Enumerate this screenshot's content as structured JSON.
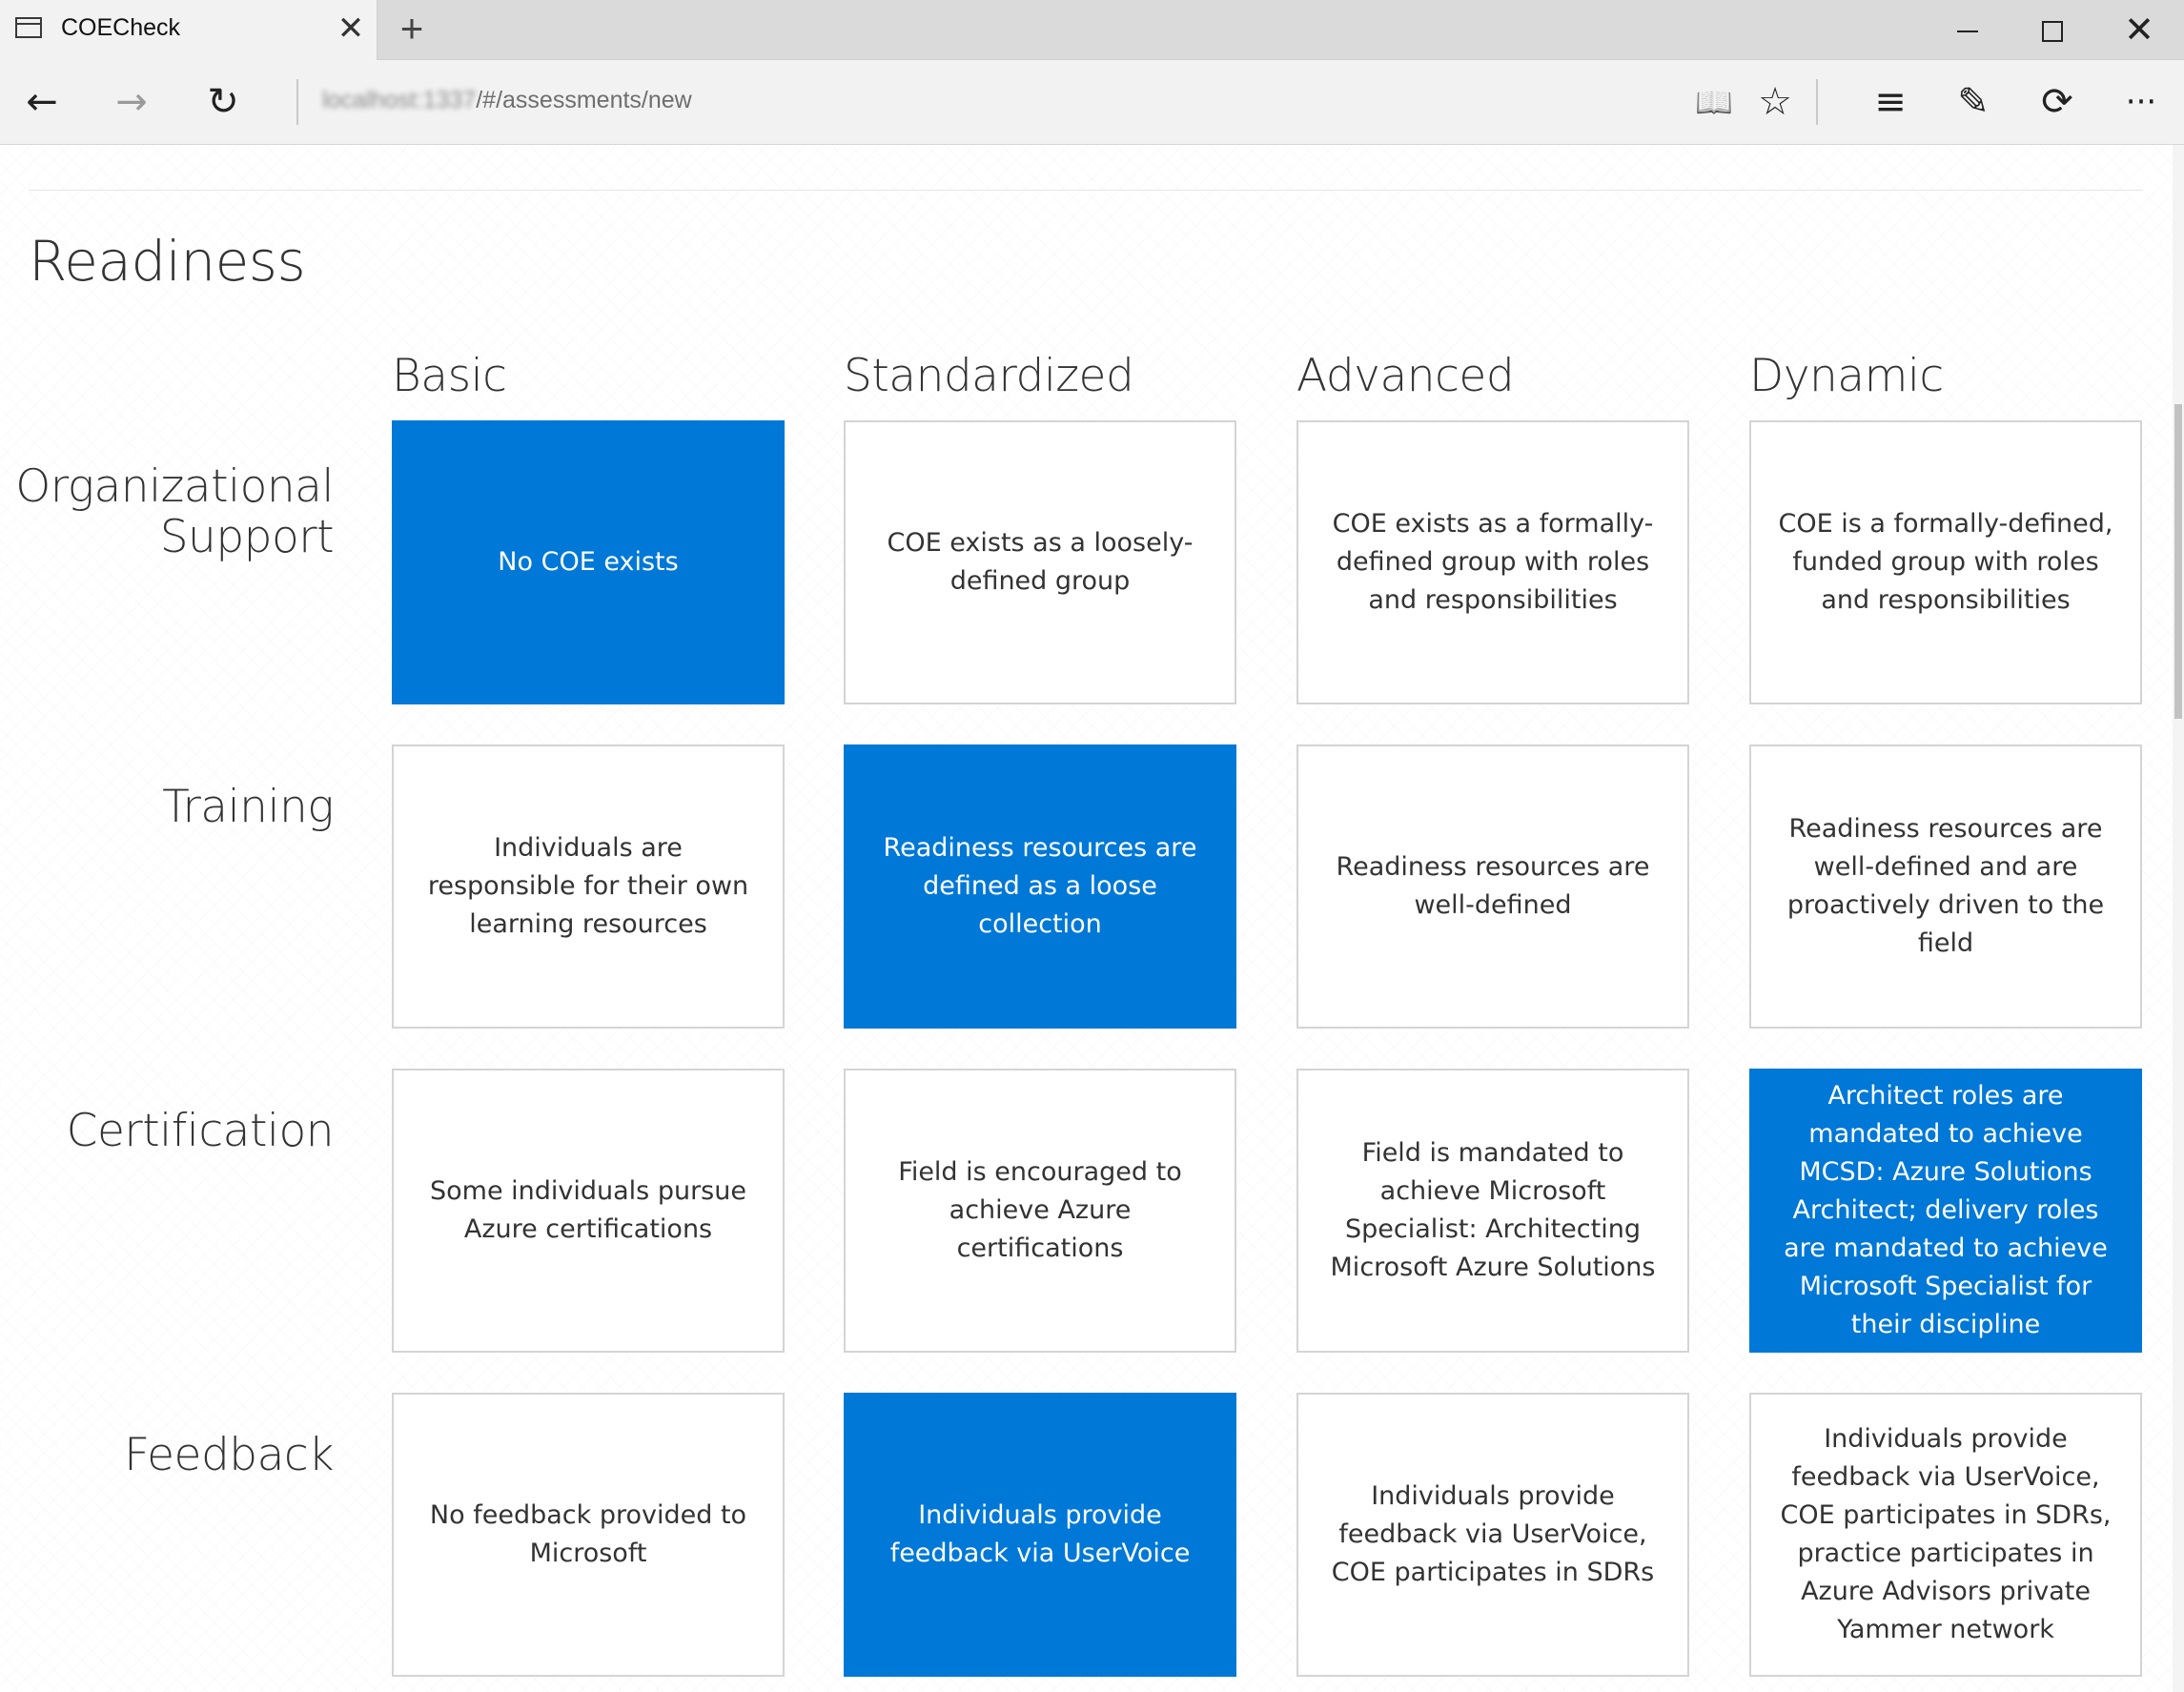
{
  "browser": {
    "tab_title": "COECheck",
    "tab_close_glyph": "✕",
    "new_tab_glyph": "+",
    "address_host": "localhost:1337",
    "address_path": "/#/assessments/new",
    "icons": [
      "back-icon",
      "forward-icon",
      "refresh-icon",
      "reading-view-icon",
      "favorite-star-icon",
      "hub-icon",
      "web-note-icon",
      "share-icon",
      "more-icon"
    ],
    "glyphs": {
      "back": "←",
      "forward": "→",
      "refresh": "↻",
      "reading": "📖",
      "favorite": "☆",
      "hub": "≡",
      "note": "✎",
      "share": "⟳",
      "more": "···",
      "close": "✕"
    }
  },
  "page": {
    "section_title": "Readiness",
    "levels": [
      "Basic",
      "Standardized",
      "Advanced",
      "Dynamic"
    ],
    "rows": [
      {
        "label": "Organizational Support",
        "selected": 0,
        "cells": [
          "No COE exists",
          "COE exists as a loosely-defined group",
          "COE exists as a formally-defined group with roles and responsibilities",
          "COE is a formally-defined, funded group with roles and responsibilities"
        ]
      },
      {
        "label": "Training",
        "selected": 1,
        "cells": [
          "Individuals are responsible for their own learning resources",
          "Readiness resources are defined as a loose collection",
          "Readiness resources are well-defined",
          "Readiness resources are well-defined and are proactively driven to the field"
        ]
      },
      {
        "label": "Certification",
        "selected": 3,
        "cells": [
          "Some individuals pursue Azure certifications",
          "Field is encouraged to achieve Azure certifications",
          "Field is mandated to achieve Microsoft Specialist: Architecting Microsoft Azure Solutions",
          "Architect roles are mandated to achieve MCSD: Azure Solutions Architect; delivery roles are mandated to achieve Microsoft Specialist for their discipline"
        ]
      },
      {
        "label": "Feedback",
        "selected": 1,
        "cells": [
          "No feedback provided to Microsoft",
          "Individuals provide feedback via UserVoice",
          "Individuals provide feedback via UserVoice, COE participates in SDRs",
          "Individuals provide feedback via UserVoice, COE participates in SDRs, practice participates in Azure Advisors private Yammer network"
        ]
      }
    ]
  },
  "colors": {
    "selected": "#0078d7",
    "card_border": "#d4d4d4",
    "text": "#333333"
  }
}
